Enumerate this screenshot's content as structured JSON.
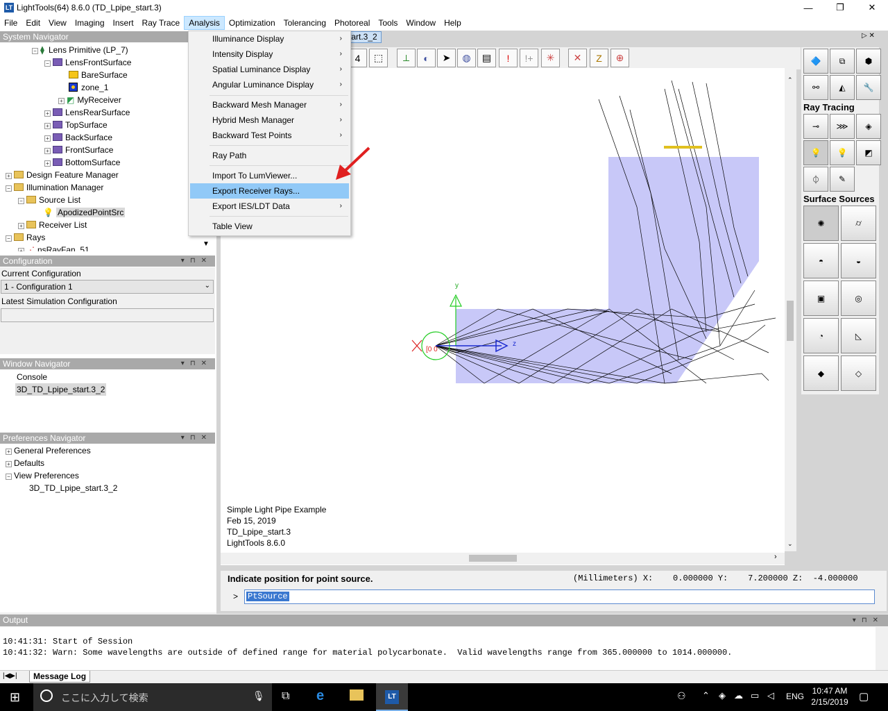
{
  "window": {
    "title": "LightTools(64) 8.6.0  (TD_Lpipe_start.3)",
    "minimize": "—",
    "restore": "❐",
    "close": "✕"
  },
  "menubar": [
    "File",
    "Edit",
    "View",
    "Imaging",
    "Insert",
    "Ray Trace",
    "Analysis",
    "Optimization",
    "Tolerancing",
    "Photoreal",
    "Tools",
    "Window",
    "Help"
  ],
  "system_navigator": {
    "header": "System Navigator",
    "items": [
      {
        "label": "Lens Primitive (LP_7)",
        "icon": "lens-icon"
      },
      {
        "label": "LensFrontSurface",
        "icon": "surface-icon"
      },
      {
        "label": "BareSurface",
        "icon": "bare-surface-icon"
      },
      {
        "label": "zone_1",
        "icon": "zone-icon"
      },
      {
        "label": "MyReceiver",
        "icon": "receiver-icon"
      },
      {
        "label": "LensRearSurface",
        "icon": "surface-icon"
      },
      {
        "label": "TopSurface",
        "icon": "surface-icon"
      },
      {
        "label": "BackSurface",
        "icon": "surface-icon"
      },
      {
        "label": "FrontSurface",
        "icon": "surface-icon"
      },
      {
        "label": "BottomSurface",
        "icon": "surface-icon"
      },
      {
        "label": "Design Feature Manager",
        "icon": "folder-icon"
      },
      {
        "label": "Illumination Manager",
        "icon": "folder-icon"
      },
      {
        "label": "Source List",
        "icon": "folder-icon"
      },
      {
        "label": "ApodizedPointSrc",
        "icon": "bulb-icon"
      },
      {
        "label": "Receiver List",
        "icon": "folder-icon"
      },
      {
        "label": "Rays",
        "icon": "folder-icon"
      },
      {
        "label": "nsRayFan_51",
        "icon": "ray-fan-icon"
      }
    ]
  },
  "configuration": {
    "header": "Configuration",
    "current_label": "Current Configuration",
    "current_value": "1 - Configuration 1",
    "latest_label": "Latest Simulation Configuration",
    "latest_value": ""
  },
  "window_navigator": {
    "header": "Window Navigator",
    "items": [
      "Console",
      "3D_TD_Lpipe_start.3_2"
    ]
  },
  "preferences_navigator": {
    "header": "Preferences Navigator",
    "items": [
      "General Preferences",
      "Defaults",
      "View Preferences",
      "3D_TD_Lpipe_start.3_2"
    ]
  },
  "view_tab": "tart.3_2",
  "analysis_menu": [
    {
      "label": "Illuminance Display",
      "submenu": true
    },
    {
      "label": "Intensity Display",
      "submenu": true
    },
    {
      "label": "Spatial Luminance Display",
      "submenu": true
    },
    {
      "label": "Angular Luminance Display",
      "submenu": true
    },
    {
      "label": "Backward Mesh Manager",
      "submenu": true
    },
    {
      "label": "Hybrid Mesh Manager",
      "submenu": true
    },
    {
      "label": "Backward Test Points",
      "submenu": true
    },
    {
      "label": "Ray Path",
      "submenu": false
    },
    {
      "label": "Import To LumViewer...",
      "submenu": false
    },
    {
      "label": "Export Receiver Rays...",
      "submenu": false,
      "highlighted": true
    },
    {
      "label": "Export IES/LDT Data",
      "submenu": true
    },
    {
      "label": "Table View",
      "submenu": false
    }
  ],
  "view_annotation": [
    "Simple Light Pipe Example",
    "Feb 15, 2019",
    "TD_Lpipe_start.3",
    "LightTools 8.6.0"
  ],
  "axes": {
    "y": "y",
    "z": "z",
    "origin": "[0 0"
  },
  "right_palette": {
    "ray_tracing": "Ray Tracing",
    "surface_sources": "Surface Sources"
  },
  "command": {
    "prompt": "Indicate position for point source.",
    "units": "(Millimeters)",
    "x_label": "X:",
    "x": "0.000000",
    "y_label": "Y:",
    "y": "7.200000",
    "z_label": "Z:",
    "z": "-4.000000",
    "chevron": ">",
    "input": "PtSource"
  },
  "output": {
    "header": "Output",
    "lines": [
      "10:41:31: Start of Session",
      "10:41:32: Warn: Some wavelengths are outside of defined range for material polycarbonate.  Valid wavelengths range from 365.000000 to 1014.000000."
    ],
    "tab": "Message Log"
  },
  "taskbar": {
    "search_placeholder": "ここに入力して検索",
    "lang": "ENG",
    "time": "10:47 AM",
    "date": "2/15/2019"
  },
  "colors": {
    "accent": "#91c9f7",
    "pipe": "#c8c8f8",
    "arrow": "#e02020"
  }
}
